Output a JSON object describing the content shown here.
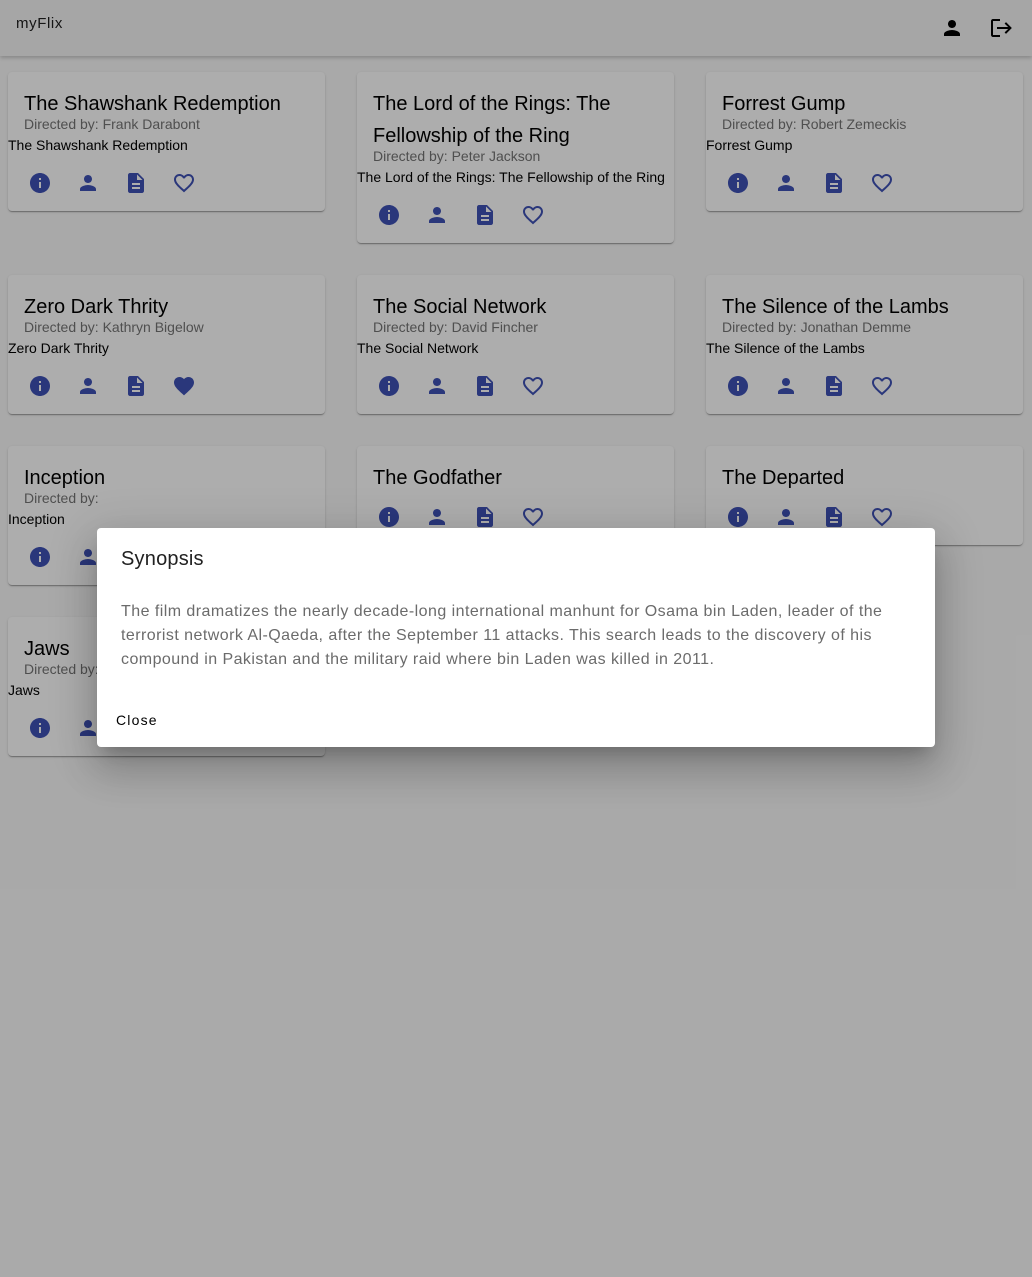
{
  "app": {
    "brand": "myFlix",
    "profile_icon": "person-icon",
    "logout_icon": "logout-icon"
  },
  "movies": [
    {
      "title": "The Shawshank Redemption",
      "director": "Directed by: Frank Darabont",
      "image_alt": "The Shawshank Redemption",
      "favorite": false
    },
    {
      "title": "The Lord of the Rings: The Fellowship of the Ring",
      "director": "Directed by: Peter Jackson",
      "image_alt": "The Lord of the Rings: The Fellowship of the Ring",
      "favorite": false
    },
    {
      "title": "Forrest Gump",
      "director": "Directed by: Robert Zemeckis",
      "image_alt": "Forrest Gump",
      "favorite": false
    },
    {
      "title": "Zero Dark Thrity",
      "director": "Directed by: Kathryn Bigelow",
      "image_alt": "Zero Dark Thrity",
      "favorite": true
    },
    {
      "title": "The Social Network",
      "director": "Directed by: David Fincher",
      "image_alt": "The Social Network",
      "favorite": false
    },
    {
      "title": "The Silence of the Lambs",
      "director": "Directed by: Jonathan Demme",
      "image_alt": "The Silence of the Lambs",
      "favorite": false
    },
    {
      "title": "Inception",
      "director": "Directed by:",
      "image_alt": "Inception",
      "favorite": false
    },
    {
      "title": "The Godfather",
      "director": "",
      "image_alt": "",
      "favorite": false
    },
    {
      "title": "The Departed",
      "director": "",
      "image_alt": "",
      "favorite": false
    },
    {
      "title": "Jaws",
      "director": "Directed by:",
      "image_alt": "Jaws",
      "favorite": false
    }
  ],
  "card_actions": [
    "info-icon",
    "person-icon",
    "description-icon",
    "favorite-icon"
  ],
  "dialog": {
    "title": "Synopsis",
    "text": "The film dramatizes the nearly decade-long international manhunt for Osama bin Laden, leader of the terrorist network Al-Qaeda, after the September 11 attacks. This search leads to the discovery of his compound in Pakistan and the military raid where bin Laden was killed in 2011.",
    "close_label": "Close"
  },
  "colors": {
    "accent": "#3f51b5",
    "backdrop": "rgba(0,0,0,0.32)"
  }
}
